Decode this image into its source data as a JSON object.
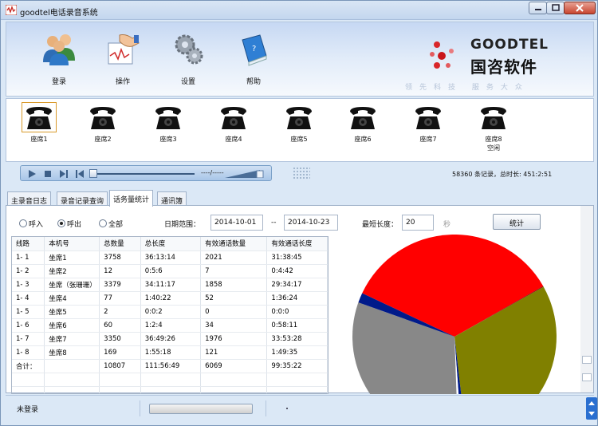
{
  "window": {
    "title": "goodtel电话录音系统"
  },
  "toolbar": {
    "items": [
      {
        "label": "登录",
        "icon": "users-icon"
      },
      {
        "label": "操作",
        "icon": "hand-wave-icon"
      },
      {
        "label": "设置",
        "icon": "gears-icon"
      },
      {
        "label": "帮助",
        "icon": "help-book-icon"
      }
    ]
  },
  "logo": {
    "brand_en": "GOODTEL",
    "brand_cn": "国咨软件",
    "slogan": "领先科技  服务大众"
  },
  "seats": [
    {
      "label": "座席1",
      "sub": ""
    },
    {
      "label": "座席2",
      "sub": ""
    },
    {
      "label": "座席3",
      "sub": ""
    },
    {
      "label": "座席4",
      "sub": ""
    },
    {
      "label": "座席5",
      "sub": ""
    },
    {
      "label": "座席6",
      "sub": ""
    },
    {
      "label": "座席7",
      "sub": ""
    },
    {
      "label": "座席8",
      "sub": "空闲"
    }
  ],
  "player": {
    "time_display": "----/-----"
  },
  "stats": {
    "text": "58360 条记录，总时长:  451:2:51"
  },
  "tabs": [
    {
      "label": "主录音日志",
      "active": false
    },
    {
      "label": "录音记录查询",
      "active": false
    },
    {
      "label": "话务量统计",
      "active": true
    },
    {
      "label": "通讯簿",
      "active": false
    }
  ],
  "filter": {
    "radio_in": "呼入",
    "radio_out": "呼出",
    "radio_all": "全部",
    "selected": "呼出",
    "date_label": "日期范围：",
    "date_from": "2014-10-01",
    "date_sep": "--",
    "date_to": "2014-10-23",
    "min_len_label": "最短长度：",
    "min_len": "20",
    "sec_unit": "秒",
    "stat_button": "统计"
  },
  "table": {
    "headers": [
      "线路",
      "本机号",
      "总数量",
      "总长度",
      "有效通话数量",
      "有效通话长度"
    ],
    "rows": [
      [
        "1- 1",
        "坐席1",
        "3758",
        "36:13:14",
        "2021",
        "31:38:45"
      ],
      [
        "1- 2",
        "坐席2",
        "12",
        "0:5:6",
        "7",
        "0:4:42"
      ],
      [
        "1- 3",
        "坐席（张珊珊）",
        "3379",
        "34:11:17",
        "1858",
        "29:34:17"
      ],
      [
        "1- 4",
        "坐席4",
        "77",
        "1:40:22",
        "52",
        "1:36:24"
      ],
      [
        "1- 5",
        "坐席5",
        "2",
        "0:0:2",
        "0",
        "0:0:0"
      ],
      [
        "1- 6",
        "坐席6",
        "60",
        "1:2:4",
        "34",
        "0:58:11"
      ],
      [
        "1- 7",
        "坐席7",
        "3350",
        "36:49:26",
        "1976",
        "33:53:28"
      ],
      [
        "1- 8",
        "坐席8",
        "169",
        "1:55:18",
        "121",
        "1:49:35"
      ],
      [
        "合计：",
        "",
        "10807",
        "111:56:49",
        "6069",
        "99:35:22"
      ],
      [
        "",
        "",
        "",
        "",
        "",
        ""
      ],
      [
        "",
        "",
        "",
        "",
        "",
        ""
      ]
    ]
  },
  "pie_colors": [
    "#ff0000",
    "#7a0000",
    "#888888",
    "#001a8a",
    "#808000"
  ],
  "statusbar": {
    "text": "未登录"
  }
}
